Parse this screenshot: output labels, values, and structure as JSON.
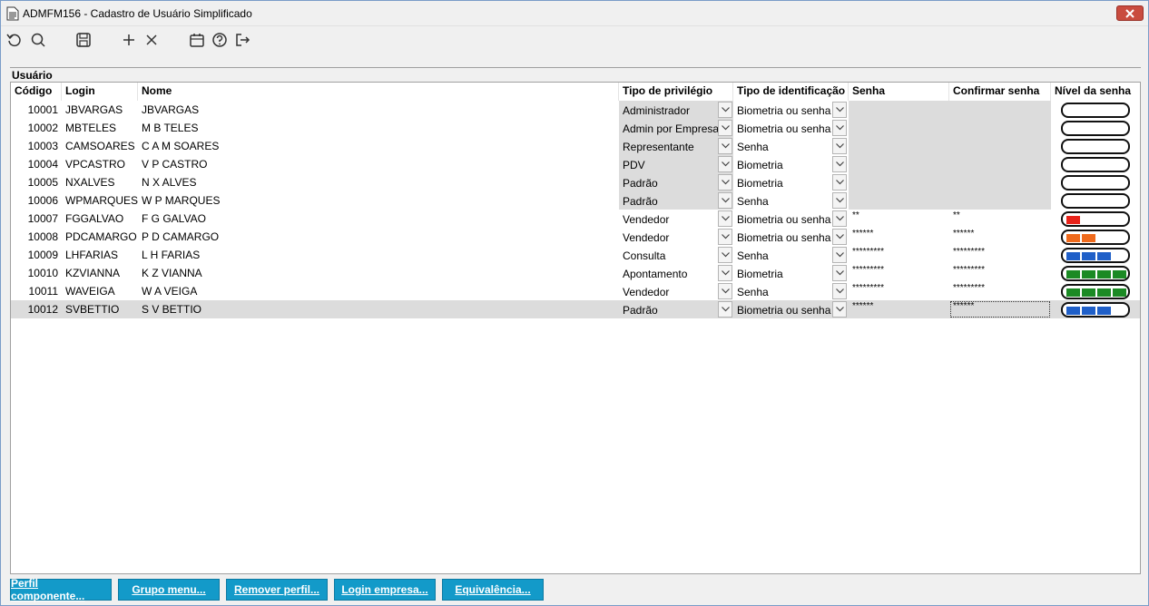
{
  "window": {
    "title": "ADMFM156 - Cadastro de Usuário Simplificado"
  },
  "toolbar": {
    "items": [
      "refresh-icon",
      "search-icon",
      "save-icon",
      "add-icon",
      "delete-icon",
      "calendar-icon",
      "help-icon",
      "exit-icon"
    ]
  },
  "section": {
    "label": "Usuário"
  },
  "columns": {
    "code": "Código",
    "login": "Login",
    "name": "Nome",
    "privilege": "Tipo de privilégio",
    "ident": "Tipo de identificação",
    "password": "Senha",
    "confirm": "Confirmar senha",
    "level": "Nível da senha"
  },
  "rows": [
    {
      "code": "10001",
      "login": "JBVARGAS",
      "name": "JBVARGAS",
      "privilege": "Administrador",
      "ident": "Biometria ou senha",
      "password": "",
      "confirm": "",
      "level": 0,
      "level_color": ""
    },
    {
      "code": "10002",
      "login": "MBTELES",
      "name": "M B TELES",
      "privilege": "Admin por Empresa",
      "ident": "Biometria ou senha",
      "password": "",
      "confirm": "",
      "level": 0,
      "level_color": ""
    },
    {
      "code": "10003",
      "login": "CAMSOARES",
      "name": "C A M SOARES",
      "privilege": "Representante",
      "ident": "Senha",
      "password": "",
      "confirm": "",
      "level": 0,
      "level_color": ""
    },
    {
      "code": "10004",
      "login": "VPCASTRO",
      "name": "V P CASTRO",
      "privilege": "PDV",
      "ident": "Biometria",
      "password": "",
      "confirm": "",
      "level": 0,
      "level_color": ""
    },
    {
      "code": "10005",
      "login": "NXALVES",
      "name": "N X ALVES",
      "privilege": "Padrão",
      "ident": "Biometria",
      "password": "",
      "confirm": "",
      "level": 0,
      "level_color": ""
    },
    {
      "code": "10006",
      "login": "WPMARQUES",
      "name": "W P MARQUES",
      "privilege": "Padrão",
      "ident": "Senha",
      "password": "",
      "confirm": "",
      "level": 0,
      "level_color": ""
    },
    {
      "code": "10007",
      "login": "FGGALVAO",
      "name": "F G GALVAO",
      "privilege": "Vendedor",
      "ident": "Biometria ou senha",
      "password": "**",
      "confirm": "**",
      "level": 1,
      "level_color": "#e8231a"
    },
    {
      "code": "10008",
      "login": "PDCAMARGO",
      "name": "P D CAMARGO",
      "privilege": "Vendedor",
      "ident": "Biometria ou senha",
      "password": "******",
      "confirm": "******",
      "level": 2,
      "level_color": "#ef6a1c"
    },
    {
      "code": "10009",
      "login": "LHFARIAS",
      "name": "L H FARIAS",
      "privilege": "Consulta",
      "ident": "Senha",
      "password": "*********",
      "confirm": "*********",
      "level": 3,
      "level_color": "#1f5fc8"
    },
    {
      "code": "10010",
      "login": "KZVIANNA",
      "name": "K Z VIANNA",
      "privilege": "Apontamento",
      "ident": "Biometria",
      "password": "*********",
      "confirm": "*********",
      "level": 4,
      "level_color": "#1b8a24"
    },
    {
      "code": "10011",
      "login": "WAVEIGA",
      "name": "W A VEIGA",
      "privilege": "Vendedor",
      "ident": "Senha",
      "password": "*********",
      "confirm": "*********",
      "level": 4,
      "level_color": "#1b8a24"
    },
    {
      "code": "10012",
      "login": "SVBETTIO",
      "name": "S V BETTIO",
      "privilege": "Padrão",
      "ident": "Biometria ou senha",
      "password": "******",
      "confirm": "******",
      "level": 3,
      "level_color": "#1f5fc8"
    }
  ],
  "selected_row": 11,
  "buttons": {
    "perfil": "Perfil componente...",
    "grupo": "Grupo menu...",
    "remover": "Remover perfil...",
    "login": "Login empresa...",
    "equiv": "Equivalência..."
  }
}
